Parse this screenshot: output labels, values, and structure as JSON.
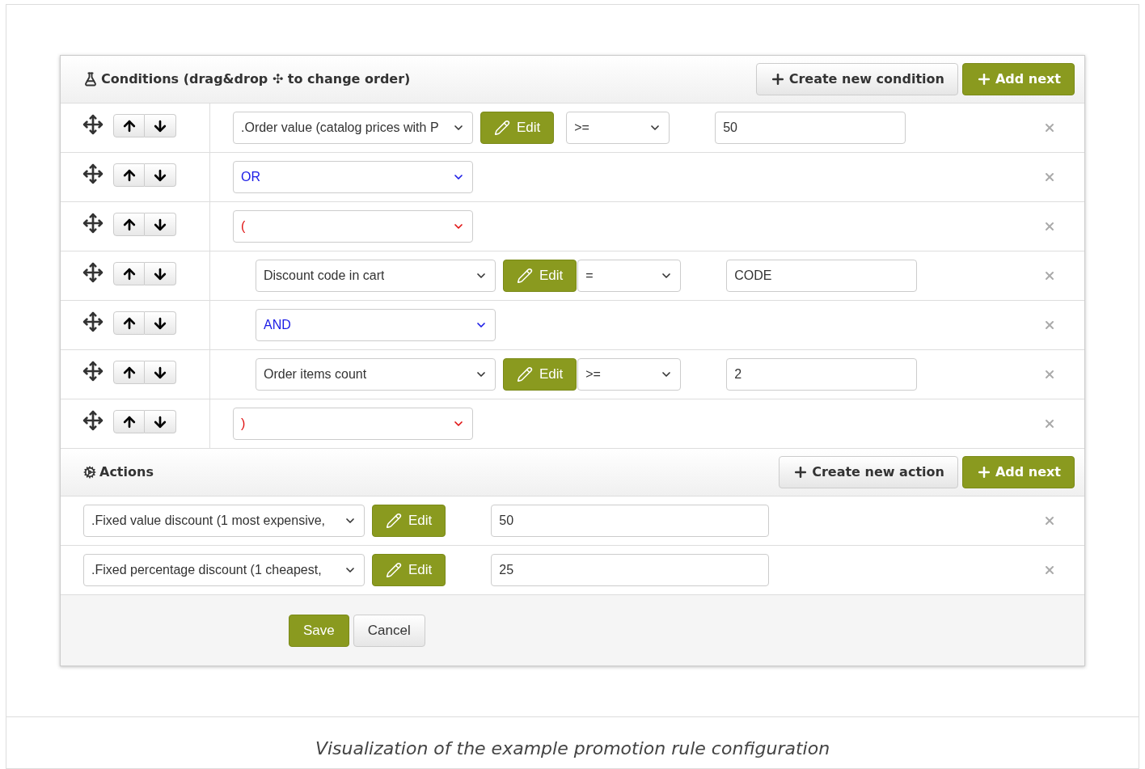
{
  "conditions": {
    "title": "Conditions (drag&drop ✣ to change order)",
    "create_button": "Create new condition",
    "add_button": "Add next",
    "rows": [
      {
        "kind": "condition",
        "field": ".Order value (catalog prices with P",
        "edit": "Edit",
        "operator": ">=",
        "value": "50"
      },
      {
        "kind": "logic",
        "field": "OR"
      },
      {
        "kind": "open",
        "field": "(",
        "children": [
          {
            "kind": "condition",
            "field": "Discount code in cart",
            "edit": "Edit",
            "operator": "=",
            "value": "CODE"
          },
          {
            "kind": "logic",
            "field": "AND"
          },
          {
            "kind": "condition",
            "field": "Order items count",
            "edit": "Edit",
            "operator": ">=",
            "value": "2"
          }
        ]
      },
      {
        "kind": "close",
        "field": ")"
      }
    ]
  },
  "actions": {
    "title": "Actions",
    "create_button": "Create new action",
    "add_button": "Add next",
    "rows": [
      {
        "field": ".Fixed value discount (1 most expensive,",
        "edit": "Edit",
        "value": "50"
      },
      {
        "field": ".Fixed percentage discount (1 cheapest,",
        "edit": "Edit",
        "value": "25"
      }
    ]
  },
  "footer": {
    "save": "Save",
    "cancel": "Cancel"
  },
  "caption": "Visualization of the example promotion rule configuration"
}
